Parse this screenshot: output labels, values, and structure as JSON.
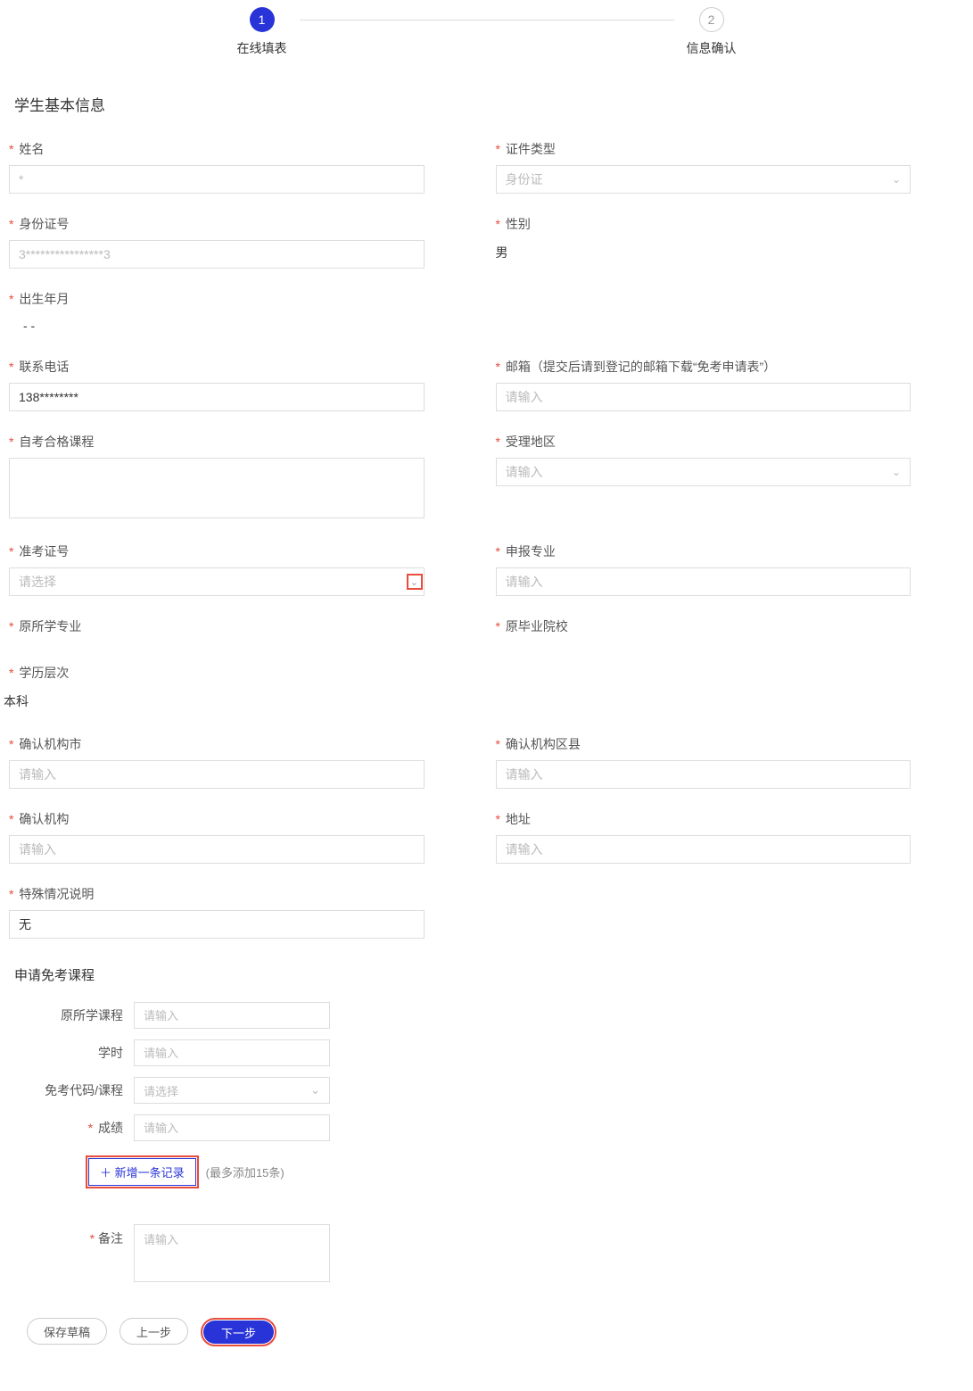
{
  "steps": {
    "step1": {
      "num": "1",
      "label": "在线填表"
    },
    "step2": {
      "num": "2",
      "label": "信息确认"
    }
  },
  "section_title": "学生基本信息",
  "fields": {
    "name": {
      "label": "姓名",
      "placeholder": "*"
    },
    "idtype": {
      "label": "证件类型",
      "value": "身份证"
    },
    "idnum": {
      "label": "身份证号",
      "placeholder": "3****************3"
    },
    "gender": {
      "label": "性别",
      "value": "男"
    },
    "birth": {
      "label": "出生年月",
      "value": "    -    -"
    },
    "phone": {
      "label": "联系电话",
      "value": "138********"
    },
    "email": {
      "label": "邮箱（提交后请到登记的邮箱下载“免考申请表”）",
      "placeholder": "请输入"
    },
    "selfcourse": {
      "label": "自考合格课程"
    },
    "region": {
      "label": "受理地区",
      "placeholder": "请输入"
    },
    "examid": {
      "label": "准考证号",
      "placeholder": "请选择"
    },
    "major": {
      "label": "申报专业",
      "placeholder": "请输入"
    },
    "origmajor": {
      "label": "原所学专业"
    },
    "origschool": {
      "label": "原毕业院校"
    },
    "edulevel": {
      "label": "学历层次",
      "value": "本科"
    },
    "confirmcity": {
      "label": "确认机构市",
      "placeholder": "请输入"
    },
    "confirmdistrict": {
      "label": "确认机构区县",
      "placeholder": "请输入"
    },
    "confirmorg": {
      "label": "确认机构",
      "placeholder": "请输入"
    },
    "address": {
      "label": "地址",
      "placeholder": "请输入"
    },
    "special": {
      "label": "特殊情况说明",
      "value": "无"
    }
  },
  "course": {
    "title": "申请免考课程",
    "origcourse": {
      "label": "原所学课程",
      "placeholder": "请输入"
    },
    "hours": {
      "label": "学时",
      "placeholder": "请输入"
    },
    "exemptcode": {
      "label": "免考代码/课程",
      "placeholder": "请选择"
    },
    "score": {
      "label": "成绩",
      "placeholder": "请输入"
    },
    "add_btn": "＋ 新增一条记录",
    "add_hint": "(最多添加15条)",
    "remark": {
      "label": "备注",
      "placeholder": "请输入"
    }
  },
  "buttons": {
    "save": "保存草稿",
    "prev": "上一步",
    "next": "下一步"
  }
}
